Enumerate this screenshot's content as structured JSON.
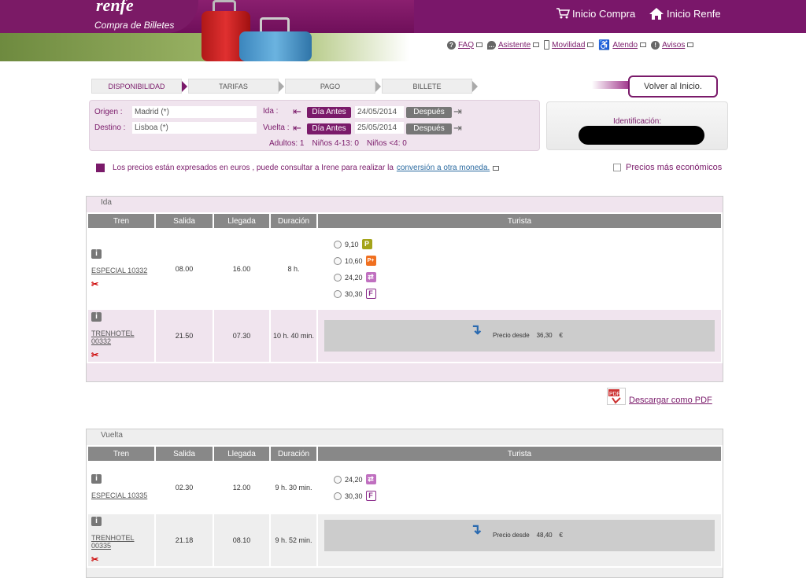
{
  "header": {
    "logo": "renfe",
    "subtitle": "Compra de Billetes",
    "links": [
      {
        "label": "Inicio Compra",
        "icon": "cart-icon"
      },
      {
        "label": "Inicio Renfe",
        "icon": "home-icon"
      }
    ],
    "utility": [
      {
        "label": "FAQ",
        "icon": "help-icon"
      },
      {
        "label": "Asistente",
        "icon": "chat-icon"
      },
      {
        "label": "Movilidad",
        "icon": "mobile-icon"
      },
      {
        "label": "Atendo",
        "icon": "accessibility-icon"
      },
      {
        "label": "Avisos",
        "icon": "alert-icon"
      }
    ]
  },
  "steps": [
    "DISPONIBILIDAD",
    "TARIFAS",
    "PAGO",
    "BILLETE"
  ],
  "volver": "Volver al Inicio.",
  "search": {
    "origen_label": "Origen :",
    "origen": "Madrid (*)",
    "destino_label": "Destino :",
    "destino": "Lisboa (*)",
    "ida_label": "Ida :",
    "vuelta_label": "Vuelta :",
    "dia_antes": "Día Antes",
    "despues": "Después",
    "ida_date": "24/05/2014",
    "vuelta_date": "25/05/2014",
    "adultos": "Adultos: 1",
    "ninos": "Niños 4-13: 0",
    "ninos_small": "Niños <4: 0"
  },
  "ident_label": "Identificación:",
  "notice": {
    "text": "Los precios están expresados en euros , puede consultar a Irene para realizar la",
    "link": "conversión a otra moneda."
  },
  "cheap_label": "Precios más económicos",
  "columns": [
    "Tren",
    "Salida",
    "Llegada",
    "Duración",
    "Turista"
  ],
  "ida": {
    "title": "Ida",
    "rows": [
      {
        "tren": "ESPECIAL 10332",
        "salida": "08.00",
        "llegada": "16.00",
        "duracion": "8 h.",
        "fares": [
          {
            "price": "9,10",
            "badge": "P"
          },
          {
            "price": "10,60",
            "badge": "P+"
          },
          {
            "price": "24,20",
            "badge": "flex"
          },
          {
            "price": "30,30",
            "badge": "F"
          }
        ]
      },
      {
        "tren": "TRENHOTEL 00332",
        "salida": "21.50",
        "llegada": "07.30",
        "duracion": "10 h. 40 min.",
        "desde_label": "Precio desde",
        "desde_price": "36,30",
        "currency": "€"
      }
    ]
  },
  "pdf_label": "Descargar como PDF",
  "vuelta": {
    "title": "Vuelta",
    "rows": [
      {
        "tren": "ESPECIAL 10335",
        "salida": "02.30",
        "llegada": "12.00",
        "duracion": "9 h. 30 min.",
        "fares": [
          {
            "price": "24,20",
            "badge": "flex"
          },
          {
            "price": "30,30",
            "badge": "F"
          }
        ]
      },
      {
        "tren": "TRENHOTEL 00335",
        "salida": "21.18",
        "llegada": "08.10",
        "duracion": "9 h. 52 min.",
        "desde_label": "Precio desde",
        "desde_price": "48,40",
        "currency": "€"
      }
    ]
  }
}
